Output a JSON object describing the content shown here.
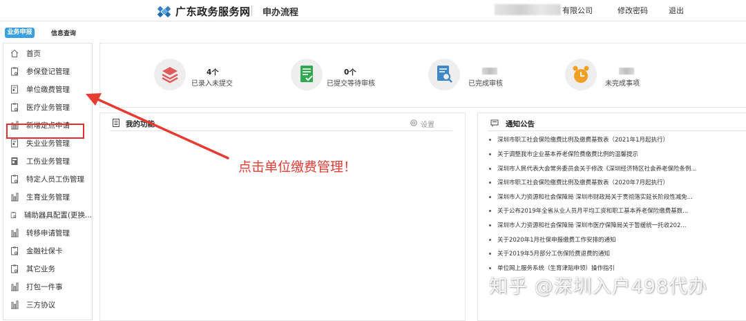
{
  "header": {
    "site_name": "广东政务服务网",
    "subtitle": "申办流程",
    "company_suffix": "有限公司",
    "change_password": "修改密码",
    "logout": "退出"
  },
  "tabs": {
    "active": "业务申报",
    "inactive": "信息查询"
  },
  "sidebar": {
    "items": [
      {
        "label": "首页",
        "icon": "home-icon"
      },
      {
        "label": "参保登记管理",
        "icon": "clipboard-icon"
      },
      {
        "label": "单位缴费管理",
        "icon": "document-icon"
      },
      {
        "label": "医疗业务管理",
        "icon": "clipboard-icon"
      },
      {
        "label": "新增定点申请",
        "icon": "chart-icon"
      },
      {
        "label": "失业业务管理",
        "icon": "document-icon"
      },
      {
        "label": "工伤业务管理",
        "icon": "document-icon"
      },
      {
        "label": "特定人员工伤管理",
        "icon": "clipboard-icon"
      },
      {
        "label": "生育业务管理",
        "icon": "chart-icon"
      },
      {
        "label": "辅助器具配置(更换...",
        "icon": "clipboard-icon"
      },
      {
        "label": "转移申请管理",
        "icon": "chart-icon"
      },
      {
        "label": "金融社保卡",
        "icon": "clipboard-icon"
      },
      {
        "label": "其它业务",
        "icon": "clipboard-icon"
      },
      {
        "label": "打包一件事",
        "icon": "chart-icon"
      },
      {
        "label": "三方协议",
        "icon": "chart-icon"
      }
    ]
  },
  "stats": [
    {
      "value": "4个",
      "label": "已录入未提交",
      "color": "#e05a5a"
    },
    {
      "value": "0个",
      "label": "已提交等待审核",
      "color": "#2fa84f"
    },
    {
      "value": "",
      "label": "已完成审核",
      "color": "#3e86c7"
    },
    {
      "value": "",
      "label": "未完成事项",
      "color": "#f0a023"
    }
  ],
  "functions_panel": {
    "title": "我的功能",
    "settings": "设置"
  },
  "notice_panel": {
    "title": "通知公告",
    "items": [
      "深圳市职工社会保险缴费比例及缴费基数表（2021年1月起执行）",
      "关于调整我市企业基本养老保险费缴费比例的温馨提示",
      "深圳市人民代表大会常务委员会关于修改《深圳经济特区社会养老保险条例...",
      "深圳市职工社会保险缴费比例及缴费基数表（2020年7月起执行）",
      "深圳市人力资源和社会保障局 深圳市财政局关于贯彻落实延长阶段性减免...",
      "关于公布2019年全省从业人员月平均工资和职工基本养老保险缴费基数...",
      "深圳市人力资源和社会保障局 深圳市医疗保障局关于暂缓统一托收202...",
      "关于2020年1月社保申报缴费工作安排的通知",
      "关于2019年5月部分工伤保险费退费的通知",
      "单位网上服务系统（生育津贴申领）操作指引"
    ]
  },
  "annotation": "点击单位缴费管理！",
  "watermark": "知乎 @深圳入户498代办",
  "colors": {
    "highlight": "#e0302b",
    "tab_active": "#3aa1de",
    "arrow": "#e63b32"
  }
}
